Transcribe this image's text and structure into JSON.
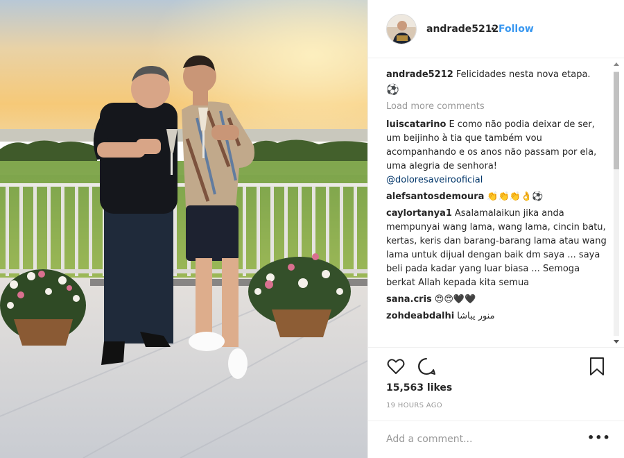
{
  "post": {
    "author": "andrade5212",
    "follow_label": "Follow",
    "separator": "•",
    "caption": {
      "user": "andrade5212",
      "text": "Felicidades nesta nova etapa.",
      "emoji": "⚽"
    },
    "load_more_label": "Load more comments",
    "comments": [
      {
        "user": "luiscatarino",
        "text": "E como não podia deixar de ser, um beijinho à tia que também vou acompanhando e os anos não passam por ela, uma alegria de senhora!",
        "mention": "@doloresaveirooficial"
      },
      {
        "user": "alefsantosdemoura",
        "text": "👏👏👏👌⚽"
      },
      {
        "user": "caylortanya1",
        "text": "Asalamalaikun jika anda mempunyai wang lama, wang lama, cincin batu, kertas, keris dan barang-barang lama atau wang lama untuk dijual dengan baik dm saya ... saya beli pada kadar yang luar biasa ... Semoga berkat Allah kepada kita semua"
      },
      {
        "user": "sana.cris",
        "text": "😍😍🖤🖤"
      },
      {
        "user": "zohdeabdalhi",
        "text": "منور يباشا"
      }
    ],
    "likes_label": "15,563 likes",
    "time_label": "19 HOURS AGO",
    "add_comment_placeholder": "Add a comment...",
    "more_label": "•••"
  },
  "icons": {
    "like": "heart-icon",
    "comment": "comment-bubble-icon",
    "save": "bookmark-icon",
    "options": "more-options-icon"
  },
  "colors": {
    "link": "#3897f0",
    "text": "#262626",
    "muted": "#999999",
    "border": "#efefef"
  }
}
